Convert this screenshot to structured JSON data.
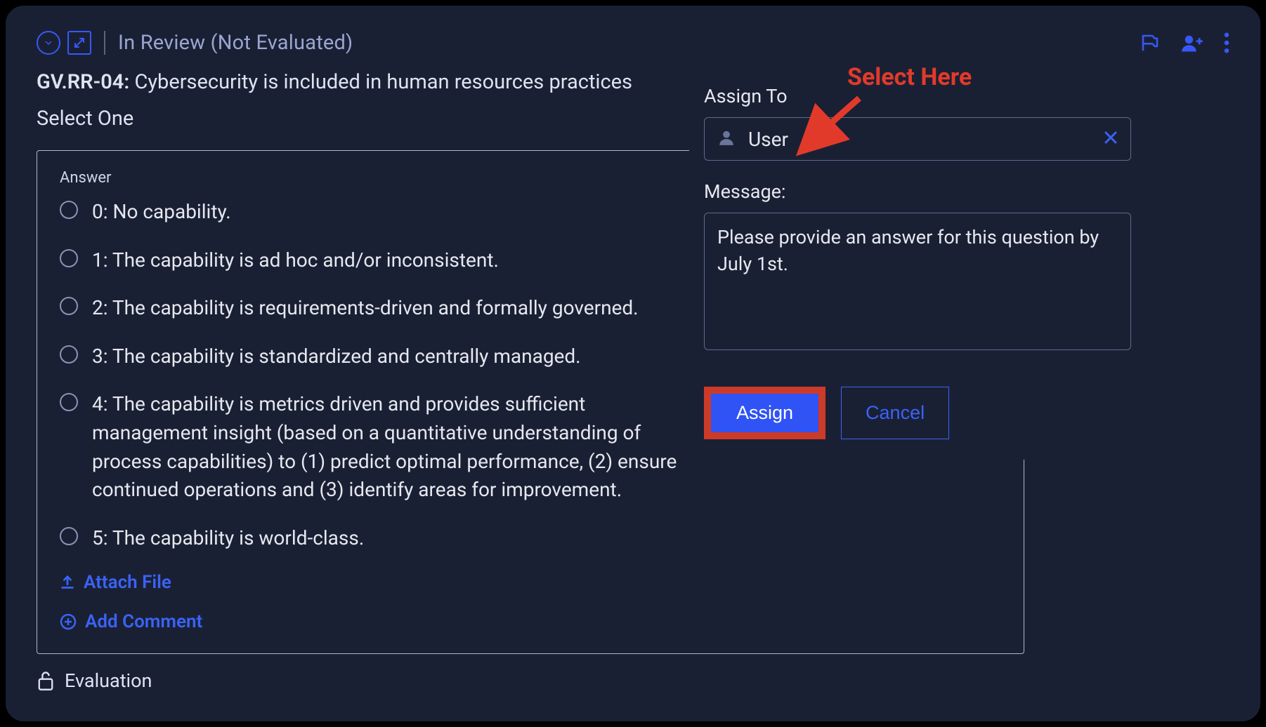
{
  "header": {
    "status": "In Review (Not Evaluated)"
  },
  "question": {
    "code": "GV.RR-04:",
    "text": "Cybersecurity is included in human resources practices",
    "instruction": "Select One"
  },
  "answer": {
    "label": "Answer",
    "options": [
      "0: No capability.",
      "1: The capability is ad hoc and/or inconsistent.",
      "2: The capability is requirements-driven and formally governed.",
      "3: The capability is standardized and centrally managed.",
      "4: The capability is metrics driven and provides sufficient management insight (based on a quantitative understanding of process capabilities) to (1) predict optimal performance, (2) ensure continued operations and (3) identify areas for improvement.",
      "5: The capability is world-class."
    ],
    "attach": "Attach File",
    "comment": "Add Comment"
  },
  "evaluation": {
    "label": "Evaluation"
  },
  "popover": {
    "assign_label": "Assign To",
    "user_value": "User",
    "message_label": "Message:",
    "message_value": "Please provide an answer for this question by July 1st.",
    "assign_btn": "Assign",
    "cancel_btn": "Cancel"
  },
  "annotation": {
    "text": "Select Here"
  }
}
